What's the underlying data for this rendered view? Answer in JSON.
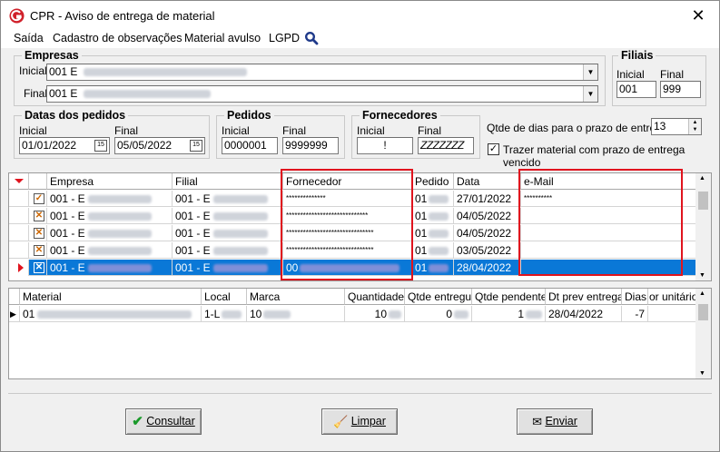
{
  "window": {
    "title": "CPR - Aviso de entrega de material",
    "close_glyph": "✕"
  },
  "menu": {
    "items": [
      "Saída",
      "Cadastro de observações",
      "Material avulso",
      "LGPD"
    ],
    "search_icon": "search-icon"
  },
  "empresas": {
    "title": "Empresas",
    "inicial_label": "Inicial",
    "inicial_value": "001 E",
    "final_label": "Final",
    "final_value": "001 E"
  },
  "filiais": {
    "title": "Filiais",
    "inicial_label": "Inicial",
    "inicial_value": "001",
    "final_label": "Final",
    "final_value": "999"
  },
  "datas": {
    "title": "Datas dos pedidos",
    "inicial_label": "Inicial",
    "inicial_value": "01/01/2022",
    "final_label": "Final",
    "final_value": "05/05/2022",
    "cal_glyph": "15"
  },
  "pedidos": {
    "title": "Pedidos",
    "inicial_label": "Inicial",
    "inicial_value": "0000001",
    "final_label": "Final",
    "final_value": "9999999"
  },
  "fornecedores": {
    "title": "Fornecedores",
    "inicial_label": "Inicial",
    "inicial_value": "!",
    "final_label": "Final",
    "final_value": "ZZZZZZZ"
  },
  "prazo": {
    "label": "Qtde de dias para o prazo de entrega",
    "value": "13",
    "check_label": "Trazer material com prazo de entrega vencido",
    "checked": true
  },
  "top_grid": {
    "columns": [
      "Empresa",
      "Filial",
      "Fornecedor",
      "Pedido",
      "Data",
      "e-Mail"
    ],
    "rows": [
      {
        "empresa": "001 - E",
        "filial": "001 - E",
        "fornecedor": "**************",
        "pedido": "01",
        "data": "27/01/2022",
        "email": "**********",
        "checked": true
      },
      {
        "empresa": "001 - E",
        "filial": "001 - E",
        "fornecedor": "*****************************",
        "pedido": "01",
        "data": "04/05/2022",
        "email": "",
        "checked": false
      },
      {
        "empresa": "001 - E",
        "filial": "001 - E",
        "fornecedor": "*******************************",
        "pedido": "01",
        "data": "04/05/2022",
        "email": "",
        "checked": false
      },
      {
        "empresa": "001 - E",
        "filial": "001 - E",
        "fornecedor": "*******************************",
        "pedido": "01",
        "data": "03/05/2022",
        "email": "",
        "checked": false
      },
      {
        "empresa": "001 - E",
        "filial": "001 - E",
        "fornecedor": "00",
        "pedido": "01",
        "data": "28/04/2022",
        "email": "",
        "checked": false,
        "selected": true
      }
    ]
  },
  "bottom_grid": {
    "columns": [
      "Material",
      "Local",
      "Marca",
      "Quantidade",
      "Qtde entregue",
      "Qtde pendente",
      "Dt prev entrega",
      "Dias",
      "or unitário"
    ],
    "rows": [
      {
        "material": "01",
        "local": "1-L",
        "marca": "10",
        "quantidade": "10",
        "entregue": "0",
        "pendente": "1",
        "dt_prev": "28/04/2022",
        "dias": "-7",
        "valor": ""
      }
    ]
  },
  "buttons": {
    "consultar": "Consultar",
    "limpar": "Limpar",
    "enviar": "Enviar"
  },
  "colors": {
    "selection": "#0a78d7",
    "highlight_box": "#e0141e",
    "indicator": "#e0141e"
  }
}
